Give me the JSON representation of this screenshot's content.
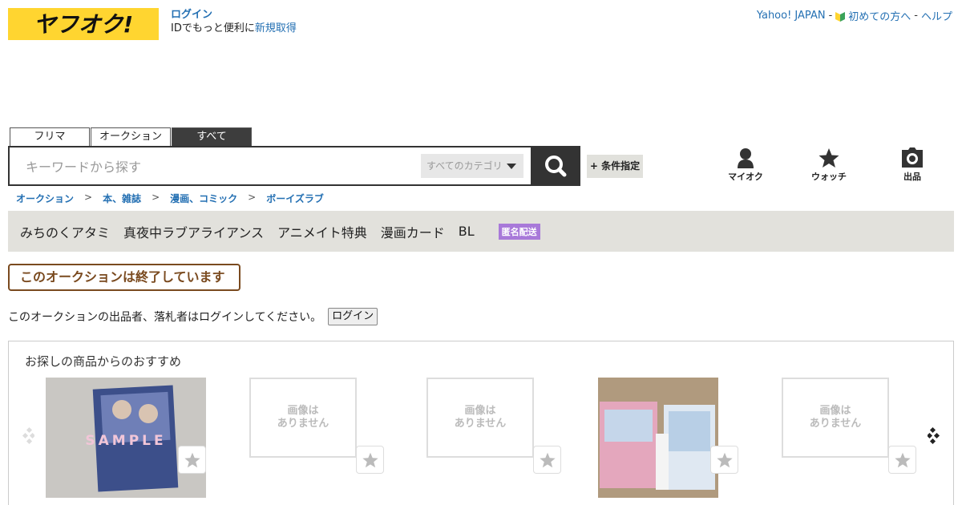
{
  "logo": {
    "text": "ヤフオク!"
  },
  "account": {
    "login_label": "ログイン",
    "prompt_text": "IDでもっと便利に",
    "register_label": "新規取得"
  },
  "top_links": {
    "yahoo_japan": "Yahoo! JAPAN",
    "sep1": "-",
    "beginners": "初めての方へ",
    "sep2": "-",
    "help": "ヘルプ"
  },
  "search": {
    "tabs": [
      {
        "label": "フリマ",
        "active": false
      },
      {
        "label": "オークション",
        "active": false
      },
      {
        "label": "すべて",
        "active": true
      }
    ],
    "placeholder": "キーワードから探す",
    "category_label": "すべてのカテゴリ",
    "condition_label": "+ 条件指定"
  },
  "nav": {
    "my_auction": "マイオク",
    "watch": "ウォッチ",
    "sell": "出品"
  },
  "breadcrumb": [
    "オークション",
    "本、雑誌",
    "漫画、コミック",
    "ボーイズラブ"
  ],
  "breadcrumb_sep": ">",
  "tags": [
    "みちのくアタミ",
    "真夜中ラブアライアンス",
    "アニメイト特典",
    "漫画カード",
    "BL"
  ],
  "tag_badge": "匿名配送",
  "status": {
    "ended_text": "このオークションは終了しています"
  },
  "login_notice": {
    "message": "このオークションの出品者、落札者はログインしてください。",
    "button_label": "ログイン"
  },
  "recommendations": {
    "title": "お探しの商品からのおすすめ",
    "no_image_line1": "画像は",
    "no_image_line2": "ありません",
    "sample_watermark": "SAMPLE"
  },
  "colors": {
    "brand_yellow": "#ffd530",
    "link_blue": "#2470b3",
    "ended_brown": "#7a4a1f",
    "badge_purple": "#a879d9"
  }
}
